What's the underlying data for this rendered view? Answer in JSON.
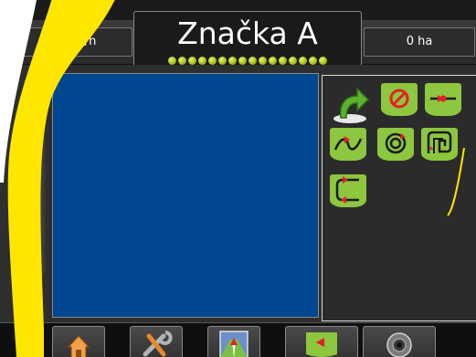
{
  "header": {
    "speed": "0.0 km/h",
    "title": "Značka A",
    "area": "0 ha",
    "satellite_dot_count": 16
  },
  "mode_panel": {
    "buttons": [
      "return-to-point-icon",
      "no-guidance-icon",
      "straight-ab-icon",
      "curved-ab-icon",
      "circle-pivot-icon",
      "last-pass-icon",
      "adaptive-curve-icon"
    ]
  },
  "bottom_tabs": [
    "home-icon",
    "tools-icon",
    "guidance-view-icon",
    "guidance-mode-icon",
    "camera-icon"
  ],
  "colors": {
    "map_blue": "#00478f",
    "accent_green": "#8dc63f",
    "highlight_yellow": "#ffe600"
  }
}
